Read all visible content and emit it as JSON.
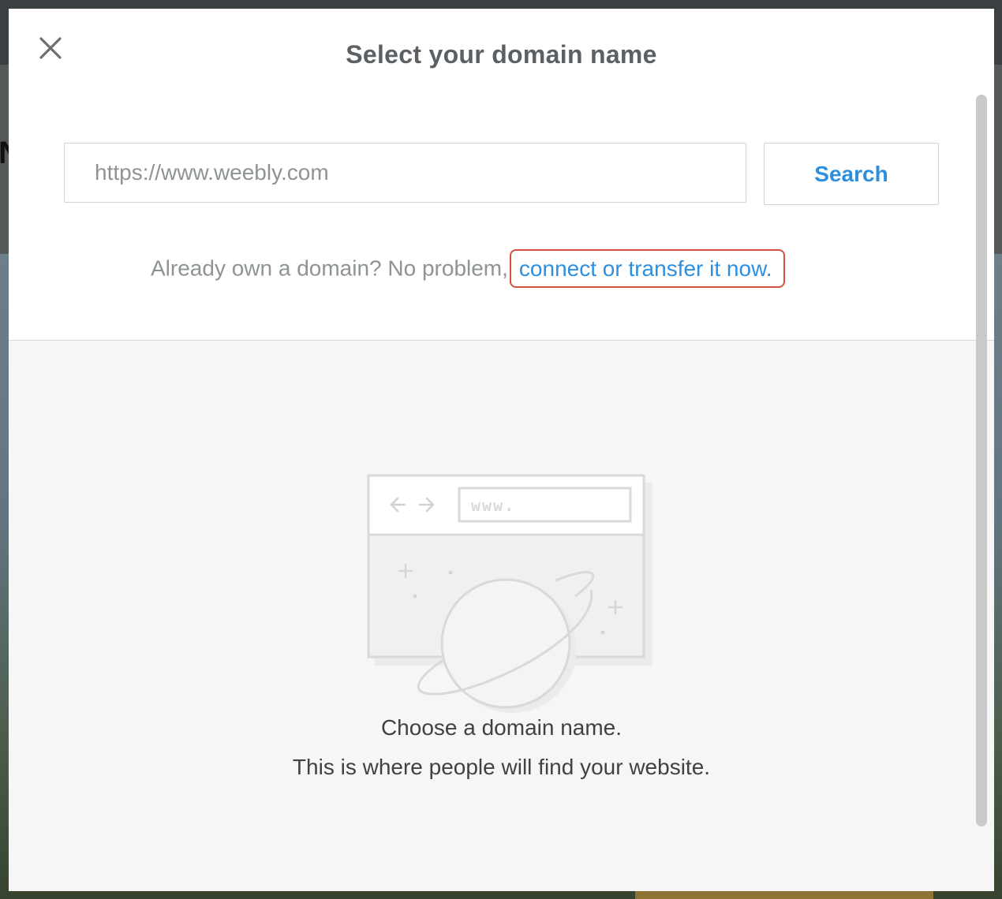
{
  "modal": {
    "title": "Select your domain name",
    "close_icon": "close-icon"
  },
  "search": {
    "placeholder": "https://www.weebly.com",
    "value": "",
    "button_label": "Search"
  },
  "own_domain": {
    "text": "Already own a domain? No problem,",
    "link_text": "connect or transfer it now."
  },
  "illustration": {
    "icon": "browser-planet-illustration",
    "url_text": "www."
  },
  "empty_state": {
    "line1": "Choose a domain name.",
    "line2": "This is where people will find your website."
  },
  "colors": {
    "accent": "#2d8fe0",
    "highlight_outline": "#d4503f",
    "title_text": "#5b6064",
    "muted_text": "#8e9396"
  }
}
